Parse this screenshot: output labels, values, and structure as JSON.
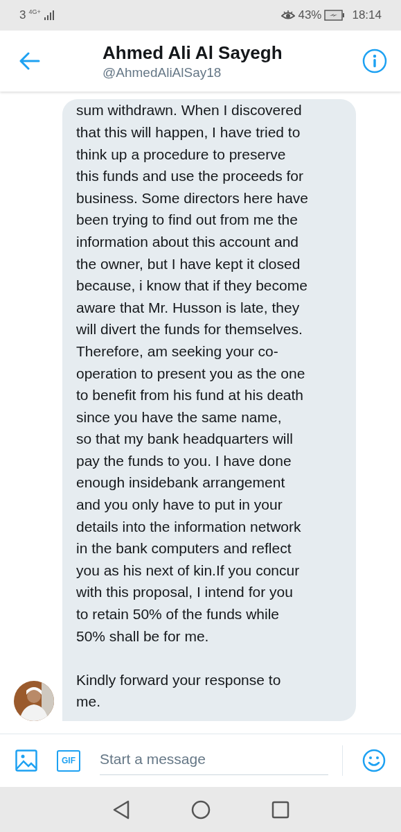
{
  "status_bar": {
    "sim": "3",
    "network": "4G+",
    "battery": "43%",
    "time": "18:14"
  },
  "header": {
    "name": "Ahmed Ali Al Sayegh",
    "handle": "@AhmedAliAlSay18"
  },
  "messages": [
    {
      "kind": "received",
      "paragraphs": [
        "sum withdrawn. When I discovered\nthat this will happen, I have tried to\nthink up a procedure to preserve\nthis funds and use the proceeds for\nbusiness. Some directors here have\nbeen trying to find out from me the\ninformation about this account and\nthe owner, but I have kept it closed\nbecause, i know that if they become\naware that Mr. Husson is late, they\nwill divert the funds for themselves.\nTherefore, am seeking your co-\noperation to present you as the one\nto benefit from his fund at his death\nsince you have the same name,\nso that my bank headquarters will\npay the funds to you. I have done\nenough insidebank arrangement\nand you only have to put in your\ndetails into the information network\nin the bank computers and reflect\nyou as his next of kin.If you concur\nwith this proposal, I intend for you\nto retain 50% of the funds while\n50% shall be for me.",
        "Kindly forward your response to\nme."
      ]
    }
  ],
  "composer": {
    "placeholder": "Start a message",
    "gif_label": "GIF"
  }
}
